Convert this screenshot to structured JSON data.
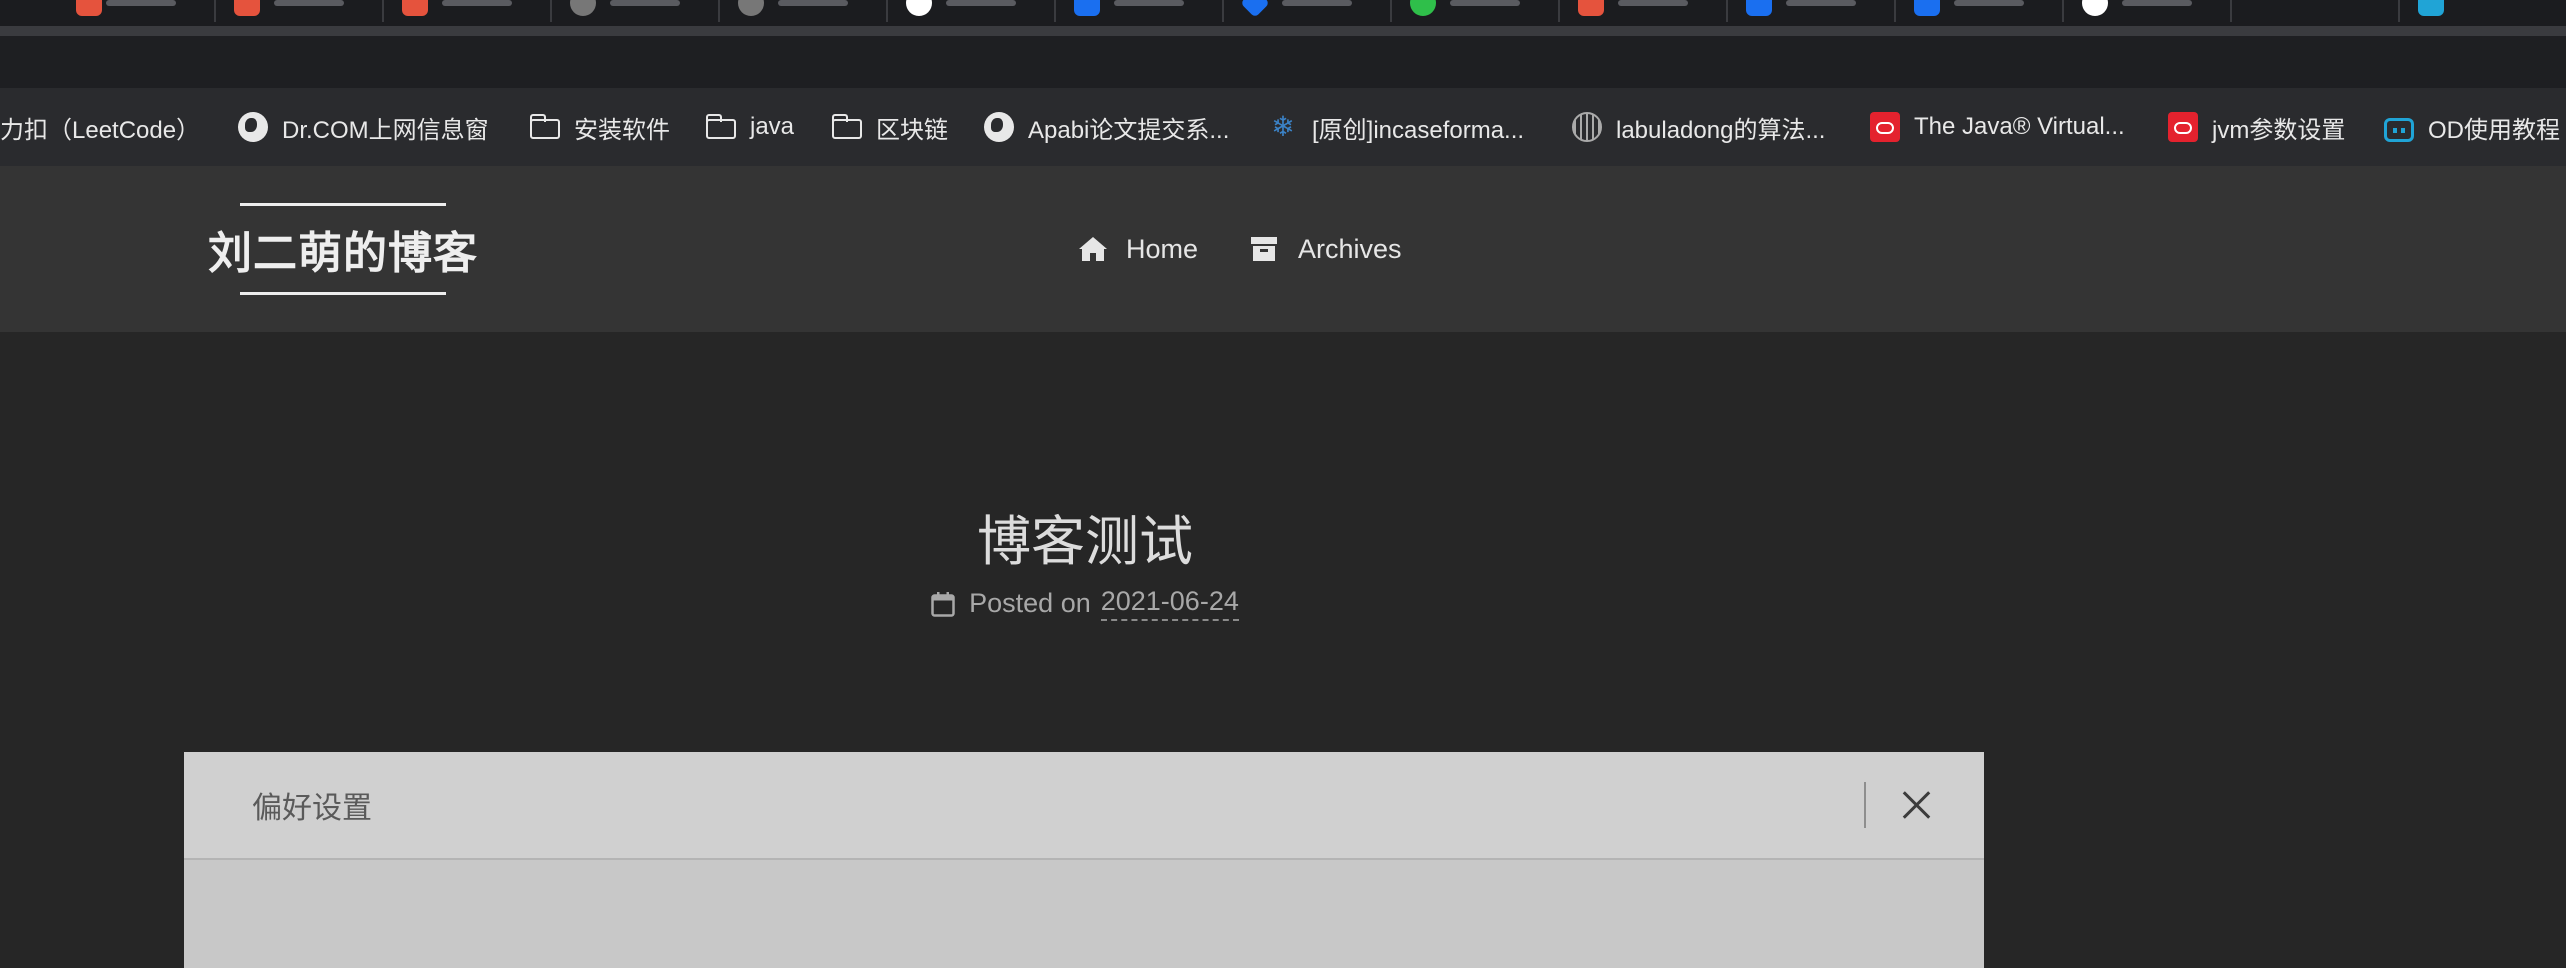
{
  "browser": {
    "tab_favicon_colors": [
      "#e5533d",
      "#e5533d",
      "#e5533d",
      "#777777",
      "#777777",
      "#ffffff",
      "#1a6ff0",
      "#1a6ff0",
      "#2fbf4a",
      "#e5533d",
      "#1a6ff0",
      "#1a6ff0",
      "#ffffff",
      "#20a4d6"
    ]
  },
  "bookmarks": [
    {
      "label": "力扣（LeetCode）",
      "icon": "none"
    },
    {
      "label": "Dr.COM上网信息窗",
      "icon": "globe-icon"
    },
    {
      "label": "安装软件",
      "icon": "folder-icon"
    },
    {
      "label": "java",
      "icon": "folder-icon"
    },
    {
      "label": "区块链",
      "icon": "folder-icon"
    },
    {
      "label": "Apabi论文提交系...",
      "icon": "globe-icon"
    },
    {
      "label": "[原创]incaseforma...",
      "icon": "snowflake-icon"
    },
    {
      "label": "labuladong的算法...",
      "icon": "labuladong-icon"
    },
    {
      "label": "The Java® Virtual...",
      "icon": "oracle-icon"
    },
    {
      "label": "jvm参数设置",
      "icon": "oracle-icon"
    },
    {
      "label": "OD使用教程",
      "icon": "bilibili-icon"
    }
  ],
  "site": {
    "brand": "刘二萌的博客",
    "nav": [
      {
        "label": "Home",
        "icon": "home-icon"
      },
      {
        "label": "Archives",
        "icon": "archive-icon"
      }
    ]
  },
  "post": {
    "title": "博客测试",
    "posted_on_label": "Posted on",
    "date": "2021-06-24"
  },
  "modal": {
    "title": "偏好设置",
    "close_icon": "close-icon"
  },
  "colors": {
    "page_bg": "#262626",
    "header_bg": "#343434",
    "bookmarks_bg": "#2a2b2e",
    "modal_bg": "#c8c8c8"
  }
}
